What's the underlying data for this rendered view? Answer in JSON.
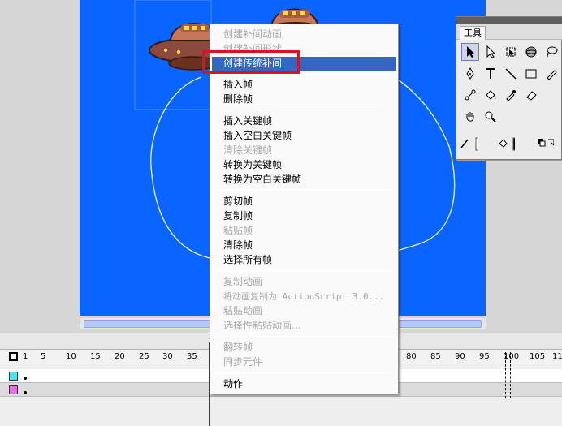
{
  "menu": {
    "items": [
      {
        "label": "创建补间动画",
        "enabled": false
      },
      {
        "label": "创建补间形状",
        "enabled": false
      },
      {
        "label": "创建传统补间",
        "enabled": true,
        "highlighted": true
      },
      {
        "label": "插入帧",
        "enabled": true
      },
      {
        "label": "删除帧",
        "enabled": true
      },
      {
        "label": "插入关键帧",
        "enabled": true
      },
      {
        "label": "插入空白关键帧",
        "enabled": true
      },
      {
        "label": "清除关键帧",
        "enabled": false
      },
      {
        "label": "转换为关键帧",
        "enabled": true
      },
      {
        "label": "转换为空白关键帧",
        "enabled": true
      },
      {
        "label": "剪切帧",
        "enabled": true
      },
      {
        "label": "复制帧",
        "enabled": true
      },
      {
        "label": "粘贴帧",
        "enabled": false
      },
      {
        "label": "清除帧",
        "enabled": true
      },
      {
        "label": "选择所有帧",
        "enabled": true
      },
      {
        "label": "复制动画",
        "enabled": false
      },
      {
        "label": "将动画复制为 ActionScript 3.0...",
        "enabled": false
      },
      {
        "label": "粘贴动画",
        "enabled": false
      },
      {
        "label": "选择性粘贴动画...",
        "enabled": false
      },
      {
        "label": "翻转帧",
        "enabled": false
      },
      {
        "label": "同步元件",
        "enabled": false
      },
      {
        "label": "动作",
        "enabled": true
      }
    ]
  },
  "tools_panel": {
    "tab_label": "工具",
    "tools": [
      "selection-arrow-icon",
      "subselection-arrow-icon",
      "free-transform-icon",
      "3d-rotation-icon",
      "lasso-icon",
      "pen-icon",
      "text-icon",
      "line-icon",
      "rectangle-icon",
      "pencil-icon",
      "bone-icon",
      "paint-bucket-icon",
      "eyedropper-icon",
      "eraser-icon",
      "hand-icon",
      "zoom-icon",
      "stroke-color-icon",
      "fill-color-icon",
      "swap-colors-icon"
    ]
  },
  "timeline": {
    "ruler_labels": [
      "1",
      "5",
      "10",
      "15",
      "20",
      "25",
      "30",
      "35",
      "80",
      "85",
      "90",
      "95",
      "100",
      "105",
      "11"
    ],
    "layer_colors": [
      "#55e0f0",
      "#e070e0"
    ]
  },
  "colors": {
    "stage": "#0a64ff",
    "menu_highlight": "#3367c2",
    "annotation_box": "#e0101e",
    "playhead": "#cc0000"
  }
}
